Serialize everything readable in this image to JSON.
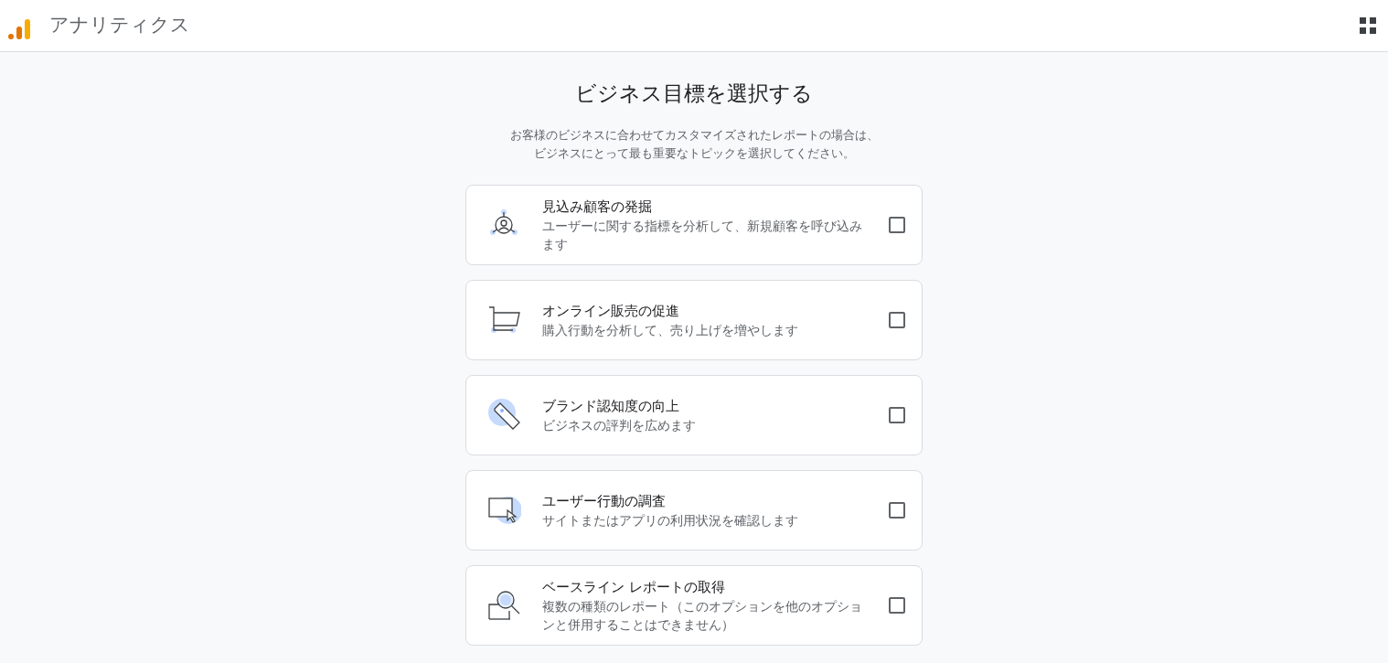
{
  "header": {
    "app_name": "アナリティクス"
  },
  "heading": "ビジネス目標を選択する",
  "intro_lines": [
    "お客様のビジネスに合わせてカスタマイズされたレポートの場合は、",
    "ビジネスにとって最も重要なトピックを選択してください。"
  ],
  "objectives": [
    {
      "title": "見込み顧客の発掘",
      "description": "ユーザーに関する指標を分析して、新規顧客を呼び込みます",
      "checked": false
    },
    {
      "title": "オンライン販売の促進",
      "description": "購入行動を分析して、売り上げを増やします",
      "checked": false
    },
    {
      "title": "ブランド認知度の向上",
      "description": "ビジネスの評判を広めます",
      "checked": false
    },
    {
      "title": "ユーザー行動の調査",
      "description": "サイトまたはアプリの利用状況を確認します",
      "checked": false
    },
    {
      "title": "ベースライン レポートの取得",
      "description": "複数の種類のレポート（このオプションを他のオプションと併用することはできません）",
      "checked": false
    }
  ]
}
